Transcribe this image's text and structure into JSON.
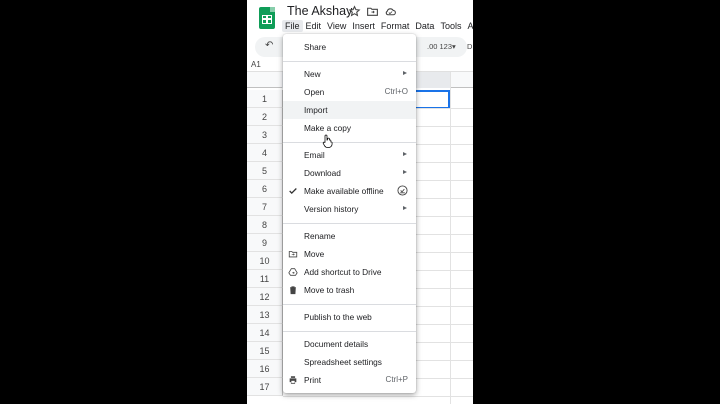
{
  "app": {
    "title": "The Akshay",
    "menus": [
      "File",
      "Edit",
      "View",
      "Insert",
      "Format",
      "Data",
      "Tools",
      "A"
    ],
    "active_menu_index": 0
  },
  "toolbar": {
    "format_text": ".00 123▾",
    "font_abbrev": "D"
  },
  "formula_bar": {
    "cell_ref": "A1"
  },
  "grid": {
    "rows": [
      "1",
      "2",
      "3",
      "4",
      "5",
      "6",
      "7",
      "8",
      "9",
      "10",
      "11",
      "12",
      "13",
      "14",
      "15",
      "16",
      "17"
    ]
  },
  "file_menu": {
    "share": "Share",
    "new": "New",
    "open": "Open",
    "open_shortcut": "Ctrl+O",
    "import": "Import",
    "make_copy": "Make a copy",
    "email": "Email",
    "download": "Download",
    "make_offline": "Make available offline",
    "version_history": "Version history",
    "rename": "Rename",
    "move": "Move",
    "add_shortcut": "Add shortcut to Drive",
    "move_trash": "Move to trash",
    "publish": "Publish to the web",
    "doc_details": "Document details",
    "spreadsheet_settings": "Spreadsheet settings",
    "print": "Print",
    "print_shortcut": "Ctrl+P"
  },
  "colors": {
    "sheets_green": "#0f9d58",
    "selection_blue": "#1a73e8",
    "hover_gray": "#f1f3f4"
  },
  "icons": [
    "star-icon",
    "move-folder-icon",
    "cloud-icon",
    "undo-icon",
    "checkmark-icon",
    "offline-icon",
    "folder-move-icon",
    "drive-shortcut-icon",
    "trash-icon",
    "print-icon",
    "hand-cursor-icon"
  ]
}
